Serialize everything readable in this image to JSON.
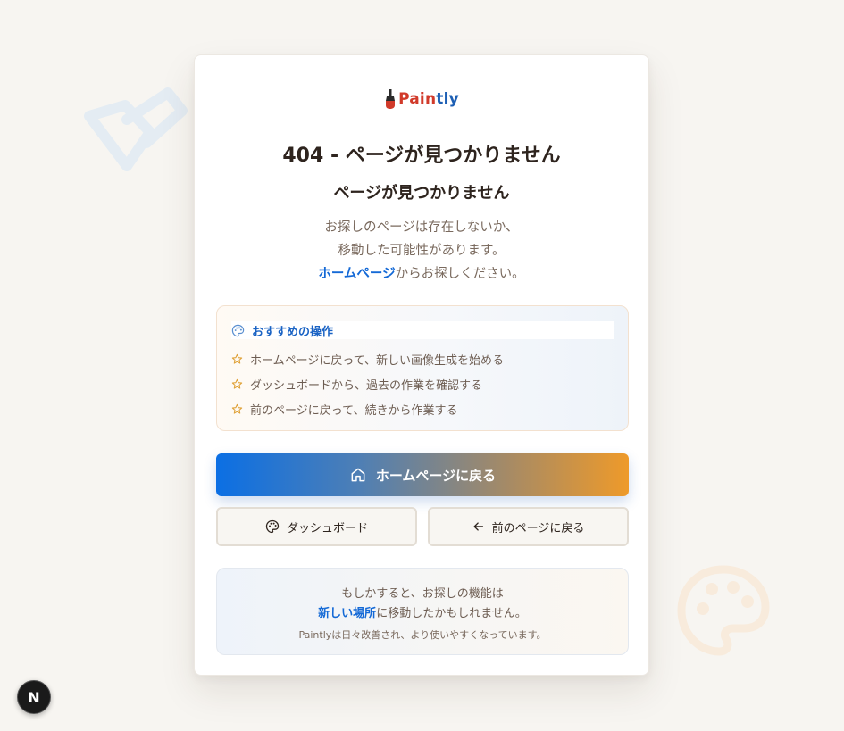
{
  "brand": {
    "logo_prefix": "Pain",
    "logo_suffix": "tly"
  },
  "error": {
    "title": "404 - ページが見つかりません",
    "subtitle": "ページが見つかりません",
    "desc_line1": "お探しのページは存在しないか、",
    "desc_line2": "移動した可能性があります。",
    "desc_link": "ホームページ",
    "desc_line3_rest": "からお探しください。"
  },
  "suggestions": {
    "title": "おすすめの操作",
    "icon": "palette-icon",
    "items": [
      {
        "label": "ホームページに戻って、新しい画像生成を始める",
        "icon": "star-icon"
      },
      {
        "label": "ダッシュボードから、過去の作業を確認する",
        "icon": "star-icon"
      },
      {
        "label": "前のページに戻って、続きから作業する",
        "icon": "star-icon"
      }
    ]
  },
  "actions": {
    "home_label": "ホームページに戻る",
    "dashboard_label": "ダッシュボード",
    "back_label": "前のページに戻る"
  },
  "info": {
    "line1": "もしかすると、お探しの機能は",
    "link": "新しい場所",
    "line2_rest": "に移動したかもしれません。",
    "note": "Paintlyは日々改善され、より使いやすくなっています。"
  },
  "dev_badge": {
    "label": "N"
  },
  "colors": {
    "accent_blue": "#1469d6",
    "accent_orange": "#ee9a2a",
    "star": "#e0a33a",
    "background": "#f7f5f1"
  }
}
